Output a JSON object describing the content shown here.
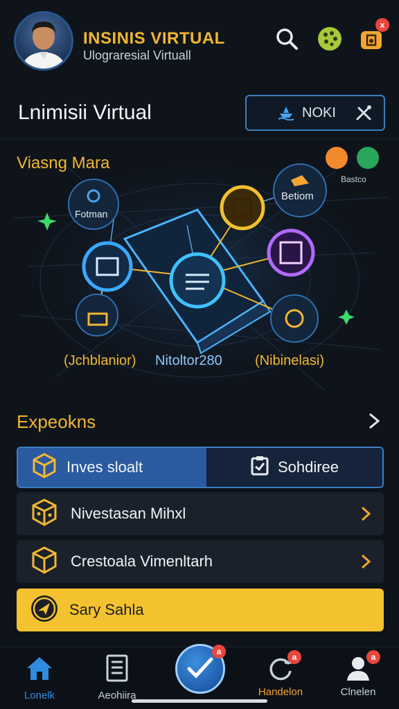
{
  "header": {
    "title": "INSINIS VIRTUAL",
    "subtitle": "Ulograresial Virtuall",
    "icons": [
      "search-icon",
      "palette-icon",
      "notification-icon"
    ],
    "notification_badge": "x"
  },
  "section": {
    "title": "Lnimisii Virtual",
    "mode_label": "NOKI"
  },
  "graph": {
    "title": "Viasng Mara",
    "top_right_label": "Bastco",
    "nodes": {
      "fotman": "Fotman",
      "betiom": "Betiom"
    },
    "bottom_labels": [
      "(Jchblanior)",
      "Nitoltor280",
      "(Nibinelasi)"
    ]
  },
  "explore": {
    "title": "Expeokns",
    "tabs": [
      {
        "label": "Inves sloalt",
        "icon": "cube-icon"
      },
      {
        "label": "Sohdiree",
        "icon": "clipboard-icon"
      }
    ],
    "items": [
      {
        "label": "Nivestasan Mihxl",
        "icon": "dice-icon"
      },
      {
        "label": "Crestoala Vimenltarh",
        "icon": "box-icon"
      }
    ],
    "cta": {
      "label": "Sary Sahla",
      "icon": "compass-icon"
    }
  },
  "bottom_nav": {
    "items": [
      {
        "label": "Lonelk",
        "icon": "home-icon",
        "color": "#2f8be0"
      },
      {
        "label": "Aeohiira",
        "icon": "document-icon",
        "color": "#c9d1db"
      },
      {
        "label": "Handelon",
        "icon": "refresh-icon",
        "color": "#f2a531",
        "badge": "a"
      },
      {
        "label": "Clnelen",
        "icon": "user-icon",
        "color": "#c9d1db",
        "badge": "a"
      }
    ],
    "fab_badge": "a"
  },
  "colors": {
    "accent": "#f2b731",
    "primary_blue": "#2a5aa0",
    "background": "#0f141b",
    "cta": "#f3c22e"
  }
}
